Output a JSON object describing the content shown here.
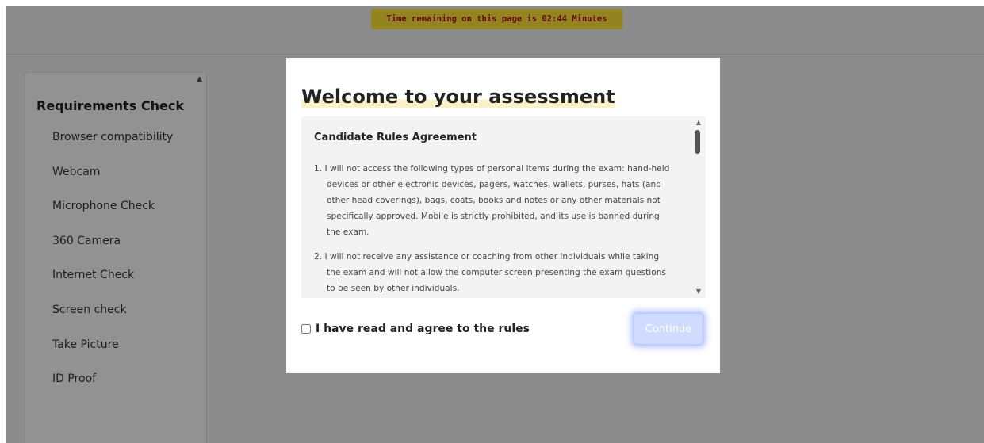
{
  "timer": {
    "text": "Time remaining on this page is 02:44 Minutes"
  },
  "sidebar": {
    "heading": "Requirements Check",
    "items": [
      {
        "label": "Browser compatibility"
      },
      {
        "label": "Webcam"
      },
      {
        "label": "Microphone Check"
      },
      {
        "label": "360 Camera"
      },
      {
        "label": "Internet Check"
      },
      {
        "label": "Screen check"
      },
      {
        "label": "Take Picture"
      },
      {
        "label": "ID Proof"
      }
    ]
  },
  "modal": {
    "title": "Welcome to your assessment",
    "rules_title": "Candidate Rules Agreement",
    "rules": [
      "1. I will not access the following types of personal items during the exam: hand-held devices or other electronic devices, pagers, watches, wallets, purses, hats (and other head coverings), bags, coats, books and notes or any other materials not specifically approved. Mobile is strictly prohibited, and its use is banned during the exam.",
      "2. I will not receive any assistance or coaching from other individuals while taking the exam and will not allow the computer screen presenting the exam questions to be seen by other individuals."
    ],
    "agree_label": "I have read and agree to the rules",
    "agree_checked": false,
    "continue_label": "Continue"
  },
  "colors": {
    "timer_bg": "#fde33a",
    "timer_text": "#b01010",
    "continue_bg": "#cfdcff",
    "title_highlight": "#fbf1c8"
  },
  "icons": {
    "sidebar_scroll": "triangle-up-icon",
    "rules_scroll_up": "triangle-up-icon",
    "rules_scroll_down": "triangle-down-icon"
  }
}
